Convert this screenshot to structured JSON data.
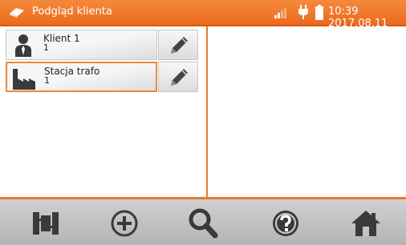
{
  "header": {
    "title": "Podgląd klienta",
    "clock": "10:39 2017.08.11"
  },
  "list": {
    "items": [
      {
        "label": "Klient 1",
        "sub": "1",
        "icon": "person-icon",
        "selected": false
      },
      {
        "label": "Stacja trafo",
        "sub": "1",
        "icon": "factory-icon",
        "selected": true
      }
    ]
  },
  "toolbar": {
    "icons": [
      "tree-structure-icon",
      "add-circle-icon",
      "search-icon",
      "help-icon",
      "home-icon"
    ]
  },
  "colors": {
    "accent": "#ec6a1e",
    "icon": "#3a3a3a"
  }
}
